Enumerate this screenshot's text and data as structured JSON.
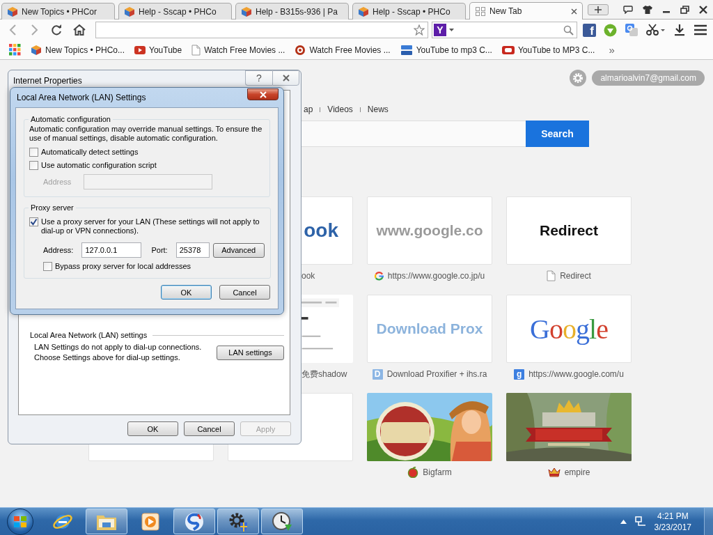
{
  "browser": {
    "tabs": [
      {
        "title": "New Topics • PHCor",
        "selected": false
      },
      {
        "title": "Help - Sscap • PHCo",
        "selected": false
      },
      {
        "title": "Help - B315s-936 | Pa",
        "selected": false
      },
      {
        "title": "Help - Sscap • PHCo",
        "selected": false
      },
      {
        "title": "New Tab",
        "selected": true
      }
    ],
    "search_engine_badge": "Y",
    "facebook_badge": "f",
    "bookmarks": [
      {
        "label": "New Topics • PHCo..."
      },
      {
        "label": "YouTube"
      },
      {
        "label": "Watch Free Movies ..."
      },
      {
        "label": "Watch Free Movies ..."
      },
      {
        "label": "YouTube to mp3 C..."
      },
      {
        "label": "YouTube to MP3 C..."
      }
    ],
    "bookmarks_more": "»"
  },
  "new_tab_page": {
    "account": "almarioalvin7@gmail.com",
    "nav": [
      "ap",
      "Videos",
      "News"
    ],
    "search_button": "Search",
    "tile_rows": [
      [
        {
          "kind": "wordmark",
          "thumb": "ook",
          "color": "#2d62a8",
          "label": "ook"
        },
        {
          "kind": "wordmark",
          "thumb": "www.google.co",
          "color": "#9a9a9a",
          "label": "https://www.google.co.jp/u"
        },
        {
          "kind": "wordmark",
          "thumb": "Redirect",
          "color": "#111111",
          "label": "Redirect"
        }
      ],
      [
        {
          "kind": "picture",
          "label": "免费shadow"
        },
        {
          "kind": "wordmark",
          "thumb": "Download Prox",
          "color": "#8cb3dc",
          "badge": "D",
          "label": "Download Proxifier + ihs.ra"
        },
        {
          "kind": "logo",
          "thumb": "Google",
          "badge": "g",
          "label": "https://www.google.com/u"
        }
      ],
      [
        {
          "kind": "empty"
        },
        {
          "kind": "empty"
        },
        {
          "kind": "picture",
          "label": "Bigfarm"
        },
        {
          "kind": "picture",
          "label": "empire"
        }
      ]
    ]
  },
  "internet_properties": {
    "title": "Internet Properties",
    "help_button": "?",
    "lan_section": {
      "heading": "Local Area Network (LAN) settings",
      "text": "LAN Settings do not apply to dial-up connections.\nChoose Settings above for dial-up settings.",
      "button": "LAN settings"
    },
    "buttons": [
      {
        "label": "OK",
        "disabled": false
      },
      {
        "label": "Cancel",
        "disabled": false
      },
      {
        "label": "Apply",
        "disabled": true
      }
    ]
  },
  "lan_dialog": {
    "title": "Local Area Network (LAN) Settings",
    "auto_group": {
      "legend": "Automatic configuration",
      "note": "Automatic configuration may override manual settings. To ensure the use of manual settings, disable automatic configuration.",
      "options": [
        {
          "label": "Automatically detect settings",
          "checked": false
        },
        {
          "label": "Use automatic configuration script",
          "checked": false
        }
      ],
      "address": {
        "label": "Address",
        "disabled": true
      }
    },
    "proxy_group": {
      "legend": "Proxy server",
      "use_proxy": {
        "label": "Use a proxy server for your LAN (These settings will not apply to dial-up or VPN connections).",
        "checked": true
      },
      "address_label": "Address:",
      "address": "127.0.0.1",
      "port_label": "Port:",
      "port": "25378",
      "advanced_button": "Advanced",
      "bypass": {
        "label": "Bypass proxy server for local addresses",
        "checked": false
      }
    },
    "buttons": [
      {
        "label": "OK",
        "default": true
      },
      {
        "label": "Cancel",
        "default": false
      }
    ]
  },
  "taskbar": {
    "apps": [
      {
        "running": false
      },
      {
        "running": true
      },
      {
        "running": false
      },
      {
        "running": true
      },
      {
        "running": true
      },
      {
        "running": true
      }
    ],
    "time": "4:21 PM",
    "date": "3/23/2017"
  }
}
